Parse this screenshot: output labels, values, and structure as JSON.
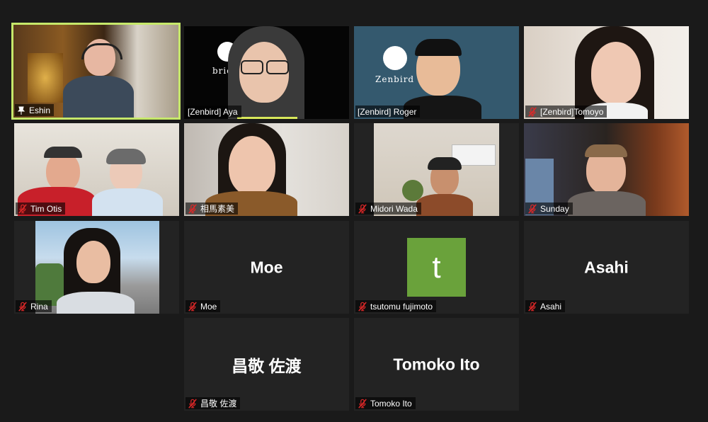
{
  "participants": [
    {
      "name": "Eshin",
      "muted": false,
      "pinned": true
    },
    {
      "name": "[Zenbird] Aya",
      "muted": false
    },
    {
      "name": "[Zenbird] Roger",
      "muted": false
    },
    {
      "name": "[Zenbird]Tomoyo",
      "muted": true
    },
    {
      "name": "Tim Otis",
      "muted": true
    },
    {
      "name": "相馬素美",
      "muted": true
    },
    {
      "name": "Midori Wada",
      "muted": true
    },
    {
      "name": "Sunday",
      "muted": true
    },
    {
      "name": "Rina",
      "muted": true
    },
    {
      "name": "Moe",
      "muted": true,
      "display": "Moe"
    },
    {
      "name": "tsutomu fujimoto",
      "muted": true,
      "avatar_letter": "t"
    },
    {
      "name": "Asahi",
      "muted": true,
      "display": "Asahi"
    },
    {
      "name": "昌敬 佐渡",
      "muted": true,
      "display": "昌敬 佐渡"
    },
    {
      "name": "Tomoko Ito",
      "muted": true,
      "display": "Tomoko Ito"
    }
  ],
  "logos": {
    "aya_backdrop": "bridm",
    "roger_backdrop": "Zenbird"
  },
  "colors": {
    "active_speaker_border": "#c6e86a",
    "muted_icon": "#e02828",
    "avatar_bg": "#6aa23b",
    "tile_bg": "#232323",
    "page_bg": "#1a1a1a"
  }
}
